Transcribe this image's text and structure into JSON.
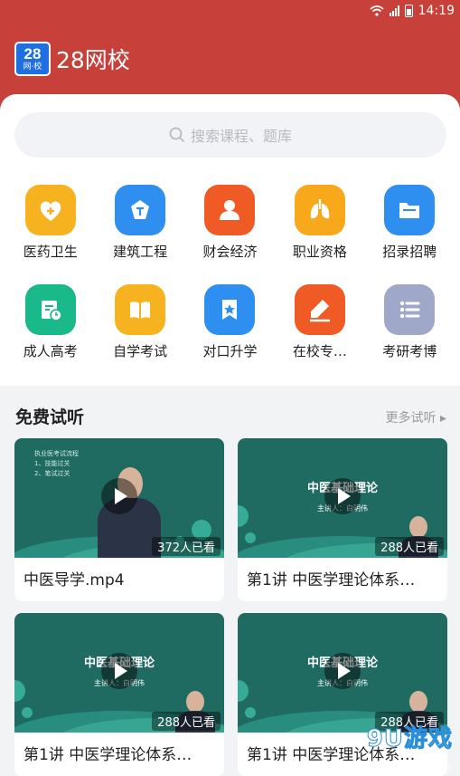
{
  "status_bar": {
    "time": "14:19"
  },
  "header": {
    "logo_number": "28",
    "logo_text": "网·校",
    "app_name": "28网校",
    "bg_color": "#c8403a"
  },
  "search": {
    "placeholder": "搜索课程、题库"
  },
  "categories": [
    {
      "label": "医药卫生",
      "icon": "heart-plus-icon",
      "color": "#f7b21f"
    },
    {
      "label": "建筑工程",
      "icon": "building-icon",
      "color": "#2f8ff0"
    },
    {
      "label": "财会经济",
      "icon": "person-icon",
      "color": "#f05a24"
    },
    {
      "label": "职业资格",
      "icon": "lungs-icon",
      "color": "#f7a81b"
    },
    {
      "label": "招录招聘",
      "icon": "folder-icon",
      "color": "#2f8ff0"
    },
    {
      "label": "成人高考",
      "icon": "calendar-clock-icon",
      "color": "#19b98a"
    },
    {
      "label": "自学考试",
      "icon": "book-icon",
      "color": "#f7b21f"
    },
    {
      "label": "对口升学",
      "icon": "bookmark-star-icon",
      "color": "#2f8ff0"
    },
    {
      "label": "在校专…",
      "icon": "pencil-icon",
      "color": "#f05a24"
    },
    {
      "label": "考研考博",
      "icon": "list-icon",
      "color": "#9fa8c9"
    }
  ],
  "free_section": {
    "title": "免费试听",
    "more": "更多试听"
  },
  "videos": [
    {
      "thumb_title": "",
      "thumb_sub": "",
      "thumb_notes": [
        "执业医考试流程",
        "1、技能过关",
        "2、笔试过关"
      ],
      "views": "372人已看",
      "caption": "中医导学.mp4"
    },
    {
      "thumb_title": "中医基础理论",
      "thumb_sub": "主讲人：白明伟",
      "thumb_notes": [],
      "views": "288人已看",
      "caption": "第1讲 中医学理论体系…"
    },
    {
      "thumb_title": "中医基础理论",
      "thumb_sub": "主讲人：白明伟",
      "thumb_notes": [],
      "views": "288人已看",
      "caption": "第1讲 中医学理论体系…"
    },
    {
      "thumb_title": "中医基础理论",
      "thumb_sub": "主讲人：白明伟",
      "thumb_notes": [],
      "views": "288人已看",
      "caption": "第1讲 中医学理论体系…"
    }
  ],
  "watermark": {
    "text": "9U游戏",
    "url": "91danji.com"
  }
}
